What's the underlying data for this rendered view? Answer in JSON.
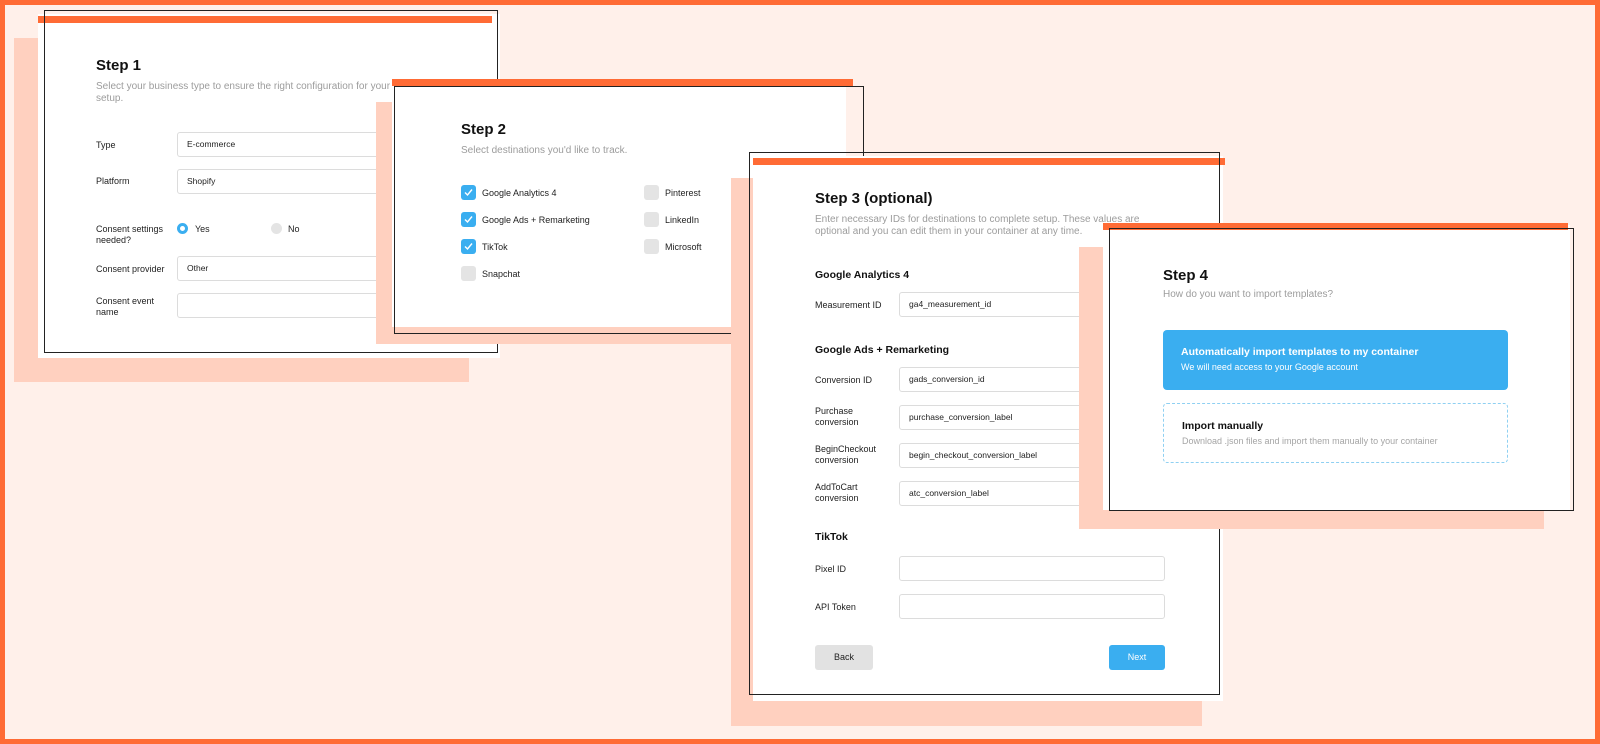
{
  "step1": {
    "title": "Step 1",
    "subtitle_line1": "Select your business type to ensure the right configuration for your tr",
    "subtitle_line2": "setup.",
    "type_label": "Type",
    "type_value": "E-commerce",
    "platform_label": "Platform",
    "platform_value": "Shopify",
    "consent_label_line1": "Consent settings",
    "consent_label_line2": "needed?",
    "consent_yes": "Yes",
    "consent_no": "No",
    "provider_label": "Consent provider",
    "provider_value": "Other",
    "event_label_line1": "Consent event",
    "event_label_line2": "name",
    "event_value": ""
  },
  "step2": {
    "title": "Step 2",
    "subtitle": "Select destinations you'd like to track.",
    "destinations": [
      {
        "label": "Google Analytics 4",
        "checked": true
      },
      {
        "label": "Google Ads + Remarketing",
        "checked": true
      },
      {
        "label": "TikTok",
        "checked": true
      },
      {
        "label": "Snapchat",
        "checked": false
      },
      {
        "label": "Pinterest",
        "checked": false
      },
      {
        "label": "LinkedIn",
        "checked": false
      },
      {
        "label": "Microsoft",
        "checked": false
      }
    ]
  },
  "step3": {
    "title": "Step 3 (optional)",
    "subtitle_line1": "Enter necessary IDs for destinations to complete setup. These values are",
    "subtitle_line2": "optional and you can edit them in your container at any time.",
    "ga4_section": "Google Analytics 4",
    "measurement_label": "Measurement ID",
    "measurement_value": "ga4_measurement_id",
    "ads_section": "Google Ads + Remarketing",
    "conversion_label": "Conversion ID",
    "conversion_value": "gads_conversion_id",
    "purchase_label_line1": "Purchase",
    "purchase_label_line2": "conversion",
    "purchase_value": "purchase_conversion_label",
    "begin_label_line1": "BeginCheckout",
    "begin_label_line2": "conversion",
    "begin_value": "begin_checkout_conversion_label",
    "atc_label_line1": "AddToCart",
    "atc_label_line2": "conversion",
    "atc_value": "atc_conversion_label",
    "tiktok_section": "TikTok",
    "pixel_label": "Pixel ID",
    "pixel_value": "",
    "token_label": "API Token",
    "token_value": "",
    "back_label": "Back",
    "next_label": "Next"
  },
  "step4": {
    "title": "Step 4",
    "subtitle": "How do you want to import templates?",
    "auto_title": "Automatically import templates to my container",
    "auto_desc": "We will need access to your Google account",
    "manual_title": "Import manually",
    "manual_desc": "Download .json files and import them manually to your container"
  },
  "colors": {
    "accent": "#ff6b35",
    "shadow": "#ffd0bf",
    "background": "#fff0ea",
    "primary": "#3aaef0"
  },
  "icons": {
    "checkmark": "check-icon"
  }
}
